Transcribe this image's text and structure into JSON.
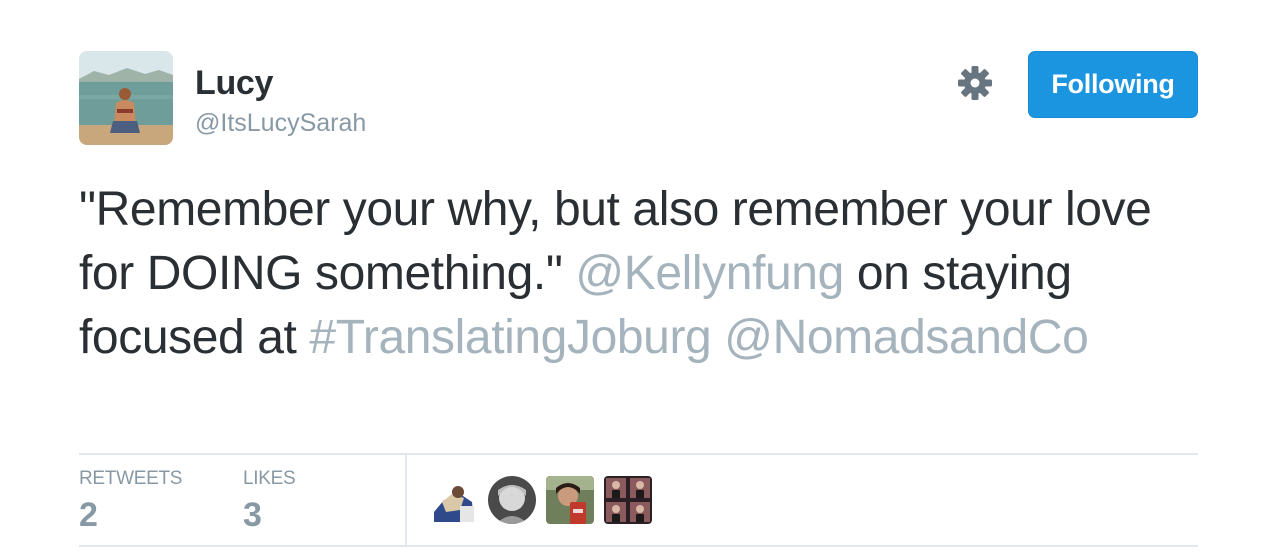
{
  "author": {
    "display_name": "Lucy",
    "screen_name": "@ItsLucySarah",
    "avatar_icon": "profile-photo"
  },
  "actions": {
    "follow_label": "Following",
    "settings_icon": "gear-icon"
  },
  "tweet": {
    "text_1": "\"Remember your why, but also remember your love for DOING something.\" ",
    "mention_1": "@Kellynfung",
    "text_2": " on staying focused at ",
    "hashtag": "#TranslatingJoburg",
    "text_3": " ",
    "mention_2": "@NomadsandCo"
  },
  "stats": {
    "retweets_label": "RETWEETS",
    "retweets_count": "2",
    "likes_label": "LIKES",
    "likes_count": "3"
  },
  "likers": [
    "liker-avatar-1",
    "liker-avatar-2",
    "liker-avatar-3",
    "liker-avatar-4"
  ],
  "colors": {
    "accent": "#1b95e0",
    "link": "#a5b3bd",
    "text": "#292f33",
    "muted": "#8899a6",
    "divider": "#e1e8ed"
  }
}
